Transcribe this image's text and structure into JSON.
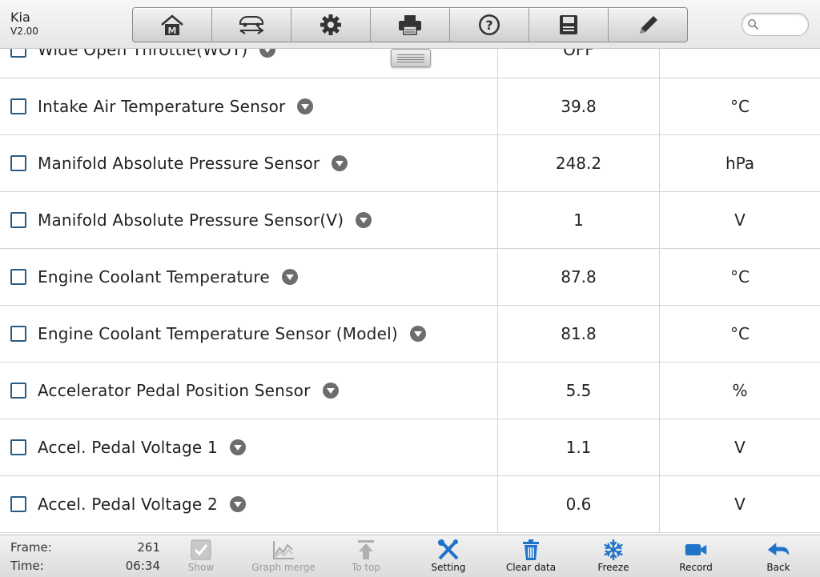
{
  "header": {
    "brand": "Kia",
    "version": "V2.00",
    "toolbar": [
      {
        "icon": "home-icon"
      },
      {
        "icon": "vehicle-swap-icon"
      },
      {
        "icon": "gear-icon"
      },
      {
        "icon": "printer-icon"
      },
      {
        "icon": "help-icon"
      },
      {
        "icon": "save-icon"
      },
      {
        "icon": "pencil-icon"
      }
    ],
    "search": {
      "value": "",
      "placeholder": ""
    }
  },
  "rows": [
    {
      "name": "Wide Open Throttle(WOT)",
      "value": "OFF",
      "unit": ""
    },
    {
      "name": "Intake Air Temperature Sensor",
      "value": "39.8",
      "unit": "°C"
    },
    {
      "name": "Manifold Absolute Pressure Sensor",
      "value": "248.2",
      "unit": "hPa"
    },
    {
      "name": "Manifold Absolute Pressure Sensor(V)",
      "value": "1",
      "unit": "V"
    },
    {
      "name": "Engine Coolant Temperature",
      "value": "87.8",
      "unit": "°C"
    },
    {
      "name": "Engine Coolant Temperature Sensor (Model)",
      "value": "81.8",
      "unit": "°C"
    },
    {
      "name": "Accelerator Pedal Position Sensor",
      "value": "5.5",
      "unit": "%"
    },
    {
      "name": "Accel. Pedal Voltage 1",
      "value": "1.1",
      "unit": "V"
    },
    {
      "name": "Accel. Pedal Voltage 2",
      "value": "0.6",
      "unit": "V"
    }
  ],
  "footer": {
    "frame_label": "Frame:",
    "frame_value": "261",
    "time_label": "Time:",
    "time_value": "06:34",
    "buttons": {
      "show": "Show",
      "graph_merge": "Graph merge",
      "to_top": "To top",
      "setting": "Setting",
      "clear_data": "Clear data",
      "freeze": "Freeze",
      "record": "Record",
      "back": "Back"
    }
  },
  "colors": {
    "accent": "#1f73c9",
    "disabled": "#9a9a9a",
    "checkbox": "#2a5d85"
  }
}
